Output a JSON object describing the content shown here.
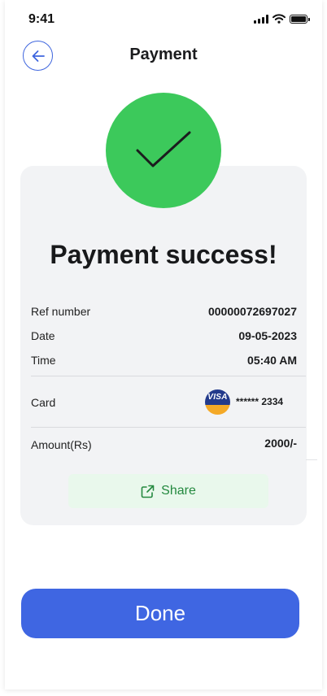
{
  "status_bar": {
    "time": "9:41"
  },
  "header": {
    "title": "Payment"
  },
  "success": {
    "title": "Payment success!"
  },
  "details": {
    "ref_label": "Ref number",
    "ref_value": "00000072697027",
    "date_label": "Date",
    "date_value": "09-05-2023",
    "time_label": "Time",
    "time_value": "05:40 AM",
    "card_label": "Card",
    "card_brand": "VISA",
    "card_number": "****** 2334",
    "amount_label": "Amount(Rs)",
    "amount_value": "2000/-"
  },
  "share": {
    "label": "Share"
  },
  "done": {
    "label": "Done"
  },
  "colors": {
    "accent": "#3f66e2",
    "success": "#3cc95b",
    "share_text": "#24893f",
    "share_bg": "#e9f8ec",
    "visa_blue": "#233a8b",
    "visa_orange": "#f4a927"
  },
  "icons": [
    "signal-icon",
    "wifi-icon",
    "battery-icon",
    "back-arrow-icon",
    "checkmark-icon",
    "visa-icon",
    "share-icon"
  ]
}
